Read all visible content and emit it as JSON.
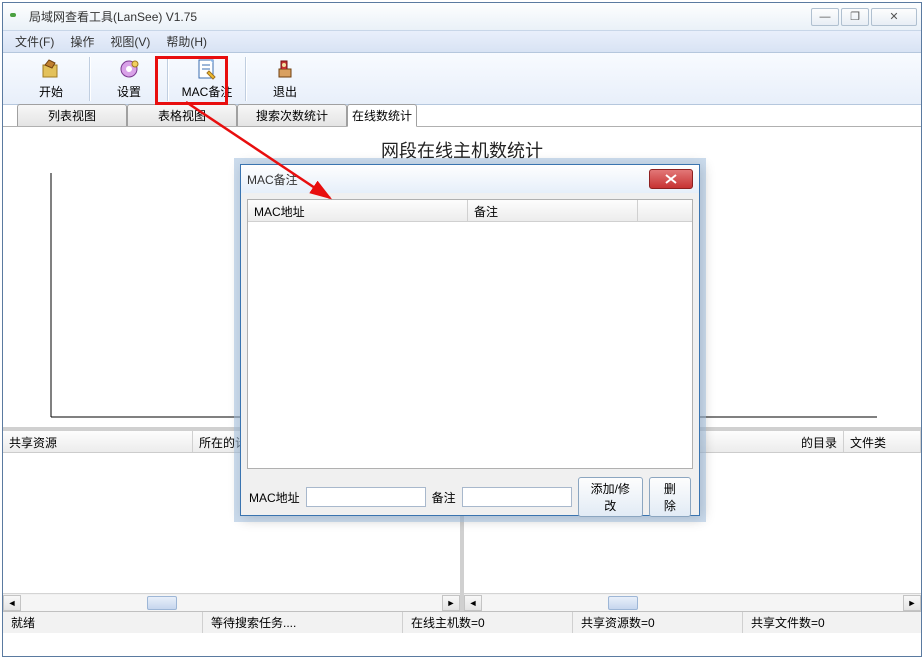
{
  "window": {
    "title": "局域网查看工具(LanSee) V1.75",
    "min": "—",
    "restore": "❐",
    "close": "✕"
  },
  "menu": {
    "file": "文件(F)",
    "operate": "操作",
    "view": "视图(V)",
    "help": "帮助(H)"
  },
  "toolbar": {
    "start": "开始",
    "settings": "设置",
    "mac_note": "MAC备注",
    "exit": "退出"
  },
  "tabs": {
    "list_view": "列表视图",
    "grid_view": "表格视图",
    "search_stats": "搜索次数统计",
    "online_stats": "在线数统计"
  },
  "chart": {
    "title": "网段在线主机数统计"
  },
  "chart_data": {
    "type": "bar",
    "title": "网段在线主机数统计",
    "categories": [],
    "values": [],
    "xlabel": "",
    "ylabel": "",
    "ylim": [
      0,
      0
    ]
  },
  "panes": {
    "left": {
      "col1": "共享资源",
      "col2": "所在的计"
    },
    "right": {
      "col1": "的目录",
      "col2": "文件类"
    }
  },
  "status": {
    "ready": "就绪",
    "waiting": "等待搜索任务....",
    "online": "在线主机数=0",
    "shared_res": "共享资源数=0",
    "shared_files": "共享文件数=0"
  },
  "dialog": {
    "title": "MAC备注",
    "col_mac": "MAC地址",
    "col_note": "备注",
    "label_mac": "MAC地址",
    "label_note": "备注",
    "btn_add": "添加/修改",
    "btn_delete": "删除",
    "mac_value": "",
    "note_value": ""
  }
}
